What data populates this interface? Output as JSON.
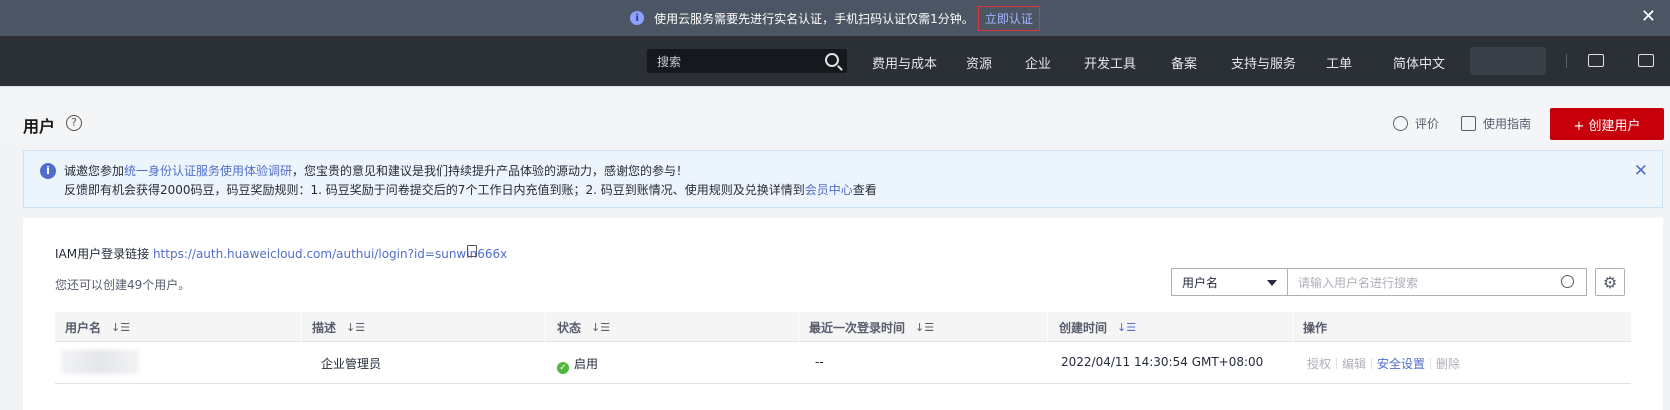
{
  "notice": {
    "text": "使用云服务需要先进行实名认证，手机扫码认证仅需1分钟。",
    "link": "立即认证",
    "close_icon": "close-icon"
  },
  "topnav": {
    "search_placeholder": "搜索",
    "items": [
      "费用与成本",
      "资源",
      "企业",
      "开发工具",
      "备案",
      "支持与服务",
      "工单",
      "简体中文"
    ]
  },
  "header": {
    "title": "用户",
    "rate_label": "评价",
    "guide_label": "使用指南",
    "create_label": "+ 创建用户"
  },
  "banner": {
    "line1_pre": "诚邀您参加",
    "line1_link": "统一身份认证服务使用体验调研",
    "line1_post": "，您宝贵的意见和建议是我们持续提升产品体验的源动力，感谢您的参与！",
    "line2_pre": "反馈即有机会获得2000码豆，码豆奖励规则：1. 码豆奖励于问卷提交后的7个工作日内充值到账；2. 码豆到账情况、使用规则及兑换详情到",
    "line2_link": "会员中心",
    "line2_post": "查看"
  },
  "content": {
    "login_label": "IAM用户登录链接",
    "login_url": "https://auth.huaweicloud.com/authui/login?id=sunwin666x",
    "quota_text": "您还可以创建49个用户。",
    "filter_value": "用户名",
    "search_placeholder": "请输入用户名进行搜索"
  },
  "table": {
    "columns": [
      "用户名",
      "描述",
      "状态",
      "最近一次登录时间",
      "创建时间",
      "操作"
    ],
    "rows": [
      {
        "description": "企业管理员",
        "status": "启用",
        "last_login": "--",
        "created": "2022/04/11 14:30:54 GMT+08:00",
        "actions": [
          "授权",
          "编辑",
          "安全设置",
          "删除"
        ]
      }
    ]
  },
  "colors": {
    "brand_red": "#c7000b",
    "link_blue": "#526ecc",
    "status_green": "#50b83c"
  }
}
